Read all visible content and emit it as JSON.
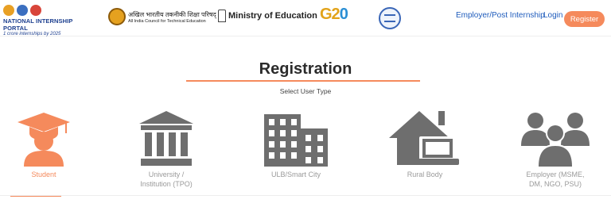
{
  "header": {
    "portal_name": "NATIONAL INTERNSHIP PORTAL",
    "portal_tagline": "1 crore internships by 2025",
    "aicte_hindi": "अखिल भारतीय तकनीकी शिक्षा परिषद्",
    "aicte_english": "All India Council for Technical Education",
    "moe_name": "Ministry of Education",
    "g20_text": "G2",
    "g20_zero": "0",
    "nav": {
      "employer": "Employer/Post Internship",
      "login": "Login",
      "register": "Register"
    }
  },
  "main": {
    "title": "Registration",
    "subtitle": "Select User Type",
    "user_types": [
      {
        "label_line1": "Student",
        "label_line2": "",
        "icon": "student-graduate-icon",
        "active": true
      },
      {
        "label_line1": "University /",
        "label_line2": "Institution (TPO)",
        "icon": "university-building-icon",
        "active": false
      },
      {
        "label_line1": "ULB/Smart City",
        "label_line2": "",
        "icon": "city-buildings-icon",
        "active": false
      },
      {
        "label_line1": "Rural Body",
        "label_line2": "",
        "icon": "house-laptop-icon",
        "active": false
      },
      {
        "label_line1": "Employer (MSME,",
        "label_line2": "DM, NGO, PSU)",
        "icon": "group-users-icon",
        "active": false
      }
    ]
  },
  "colors": {
    "accent": "#f58a5c",
    "link": "#1f5cbc",
    "icon_gray": "#6e6e6e",
    "label_gray": "#9a9a9a"
  }
}
